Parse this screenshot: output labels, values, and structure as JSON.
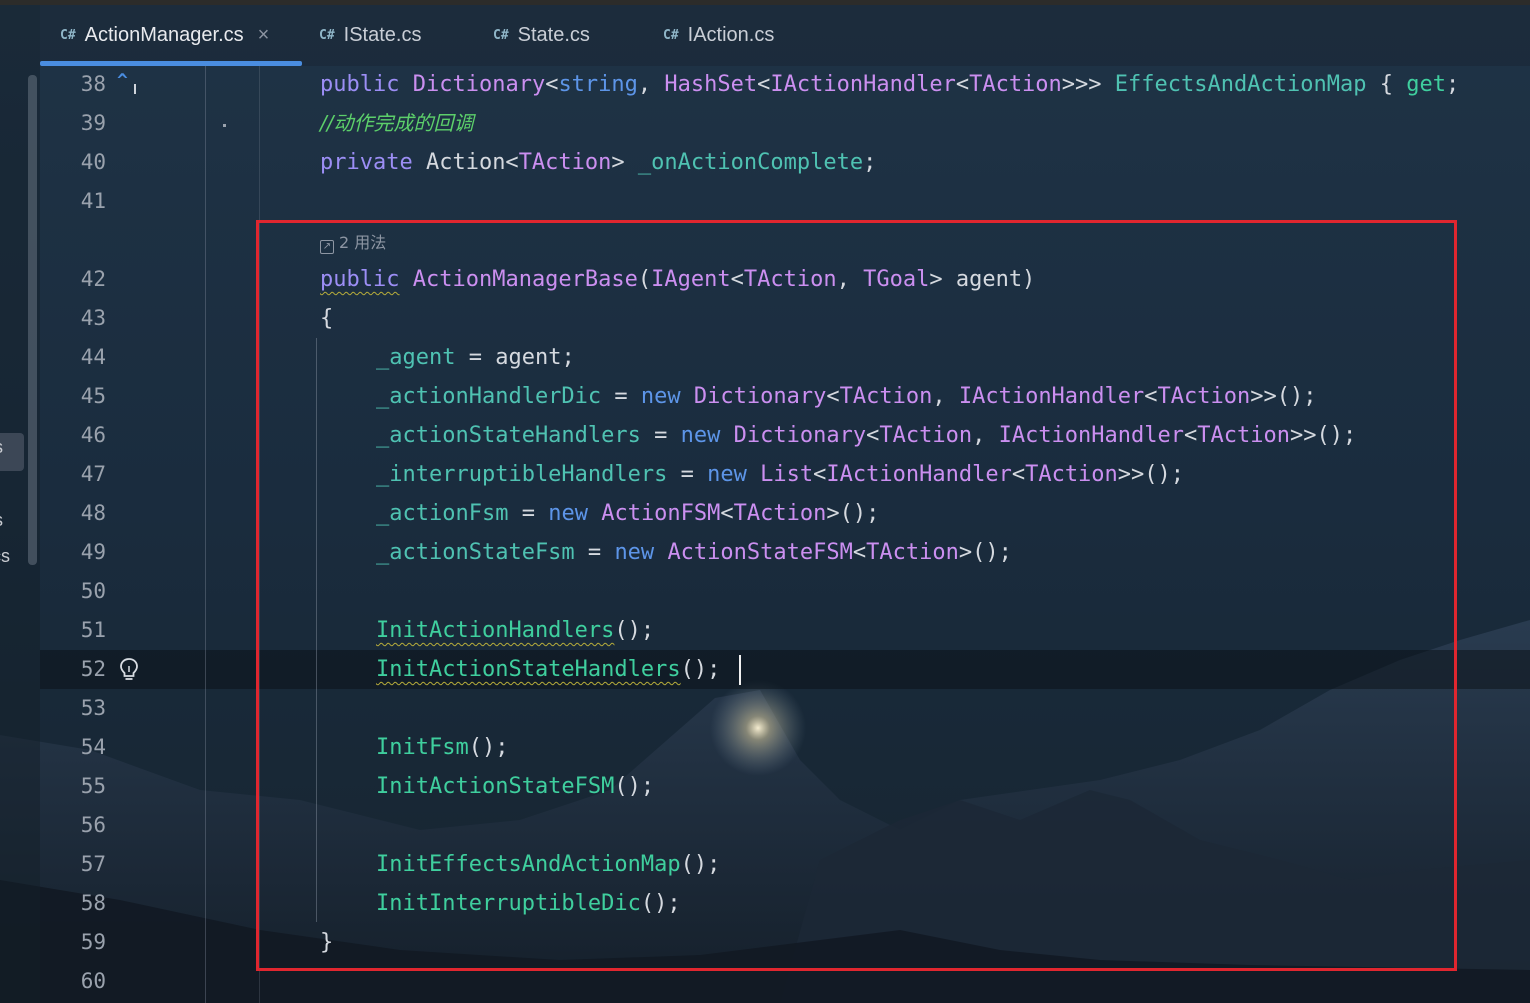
{
  "tabs": [
    {
      "icon": "C#",
      "label": "ActionManager.cs",
      "active": true,
      "close": "×"
    },
    {
      "icon": "C#",
      "label": "IState.cs",
      "active": false
    },
    {
      "icon": "C#",
      "label": "State.cs",
      "active": false
    },
    {
      "icon": "C#",
      "label": "IAction.cs",
      "active": false
    }
  ],
  "left_panel": {
    "clipped_items": [
      "s",
      "s",
      "cs"
    ]
  },
  "editor": {
    "line_numbers": [
      "38",
      "39",
      "40",
      "41",
      "42",
      "43",
      "44",
      "45",
      "46",
      "47",
      "48",
      "49",
      "50",
      "51",
      "52",
      "53",
      "54",
      "55",
      "56",
      "57",
      "58",
      "59",
      "60"
    ],
    "inlay_usages": "2 用法",
    "lines": {
      "l38": [
        {
          "c": "k",
          "t": "public"
        },
        {
          "c": "p",
          "t": " "
        },
        {
          "c": "t",
          "t": "Dictionary"
        },
        {
          "c": "p",
          "t": "<"
        },
        {
          "c": "kb",
          "t": "string"
        },
        {
          "c": "p",
          "t": ", "
        },
        {
          "c": "t",
          "t": "HashSet"
        },
        {
          "c": "p",
          "t": "<"
        },
        {
          "c": "t",
          "t": "IActionHandler"
        },
        {
          "c": "p",
          "t": "<"
        },
        {
          "c": "t",
          "t": "TAction"
        },
        {
          "c": "p",
          "t": ">>> "
        },
        {
          "c": "f",
          "t": "EffectsAndActionMap"
        },
        {
          "c": "p",
          "t": " { "
        },
        {
          "c": "m",
          "t": "get"
        },
        {
          "c": "p",
          "t": ";"
        }
      ],
      "l39": [
        {
          "c": "c",
          "t": "//动作完成的回调"
        }
      ],
      "l40": [
        {
          "c": "k",
          "t": "private"
        },
        {
          "c": "p",
          "t": " Action<"
        },
        {
          "c": "t",
          "t": "TAction"
        },
        {
          "c": "p",
          "t": "> "
        },
        {
          "c": "f",
          "t": "_onActionComplete"
        },
        {
          "c": "p",
          "t": ";"
        }
      ],
      "l42": [
        {
          "c": "k squig",
          "t": "public"
        },
        {
          "c": "p",
          "t": " "
        },
        {
          "c": "t",
          "t": "ActionManagerBase"
        },
        {
          "c": "p",
          "t": "("
        },
        {
          "c": "t",
          "t": "IAgent"
        },
        {
          "c": "p",
          "t": "<"
        },
        {
          "c": "t",
          "t": "TAction"
        },
        {
          "c": "p",
          "t": ", "
        },
        {
          "c": "t",
          "t": "TGoal"
        },
        {
          "c": "p",
          "t": "> agent)"
        }
      ],
      "l43": [
        {
          "c": "p",
          "t": "{"
        }
      ],
      "l44": [
        {
          "c": "f",
          "t": "_agent"
        },
        {
          "c": "p",
          "t": " = agent;"
        }
      ],
      "l45": [
        {
          "c": "f",
          "t": "_actionHandlerDic"
        },
        {
          "c": "p",
          "t": " = "
        },
        {
          "c": "kb",
          "t": "new"
        },
        {
          "c": "p",
          "t": " "
        },
        {
          "c": "t",
          "t": "Dictionary"
        },
        {
          "c": "p",
          "t": "<"
        },
        {
          "c": "t",
          "t": "TAction"
        },
        {
          "c": "p",
          "t": ", "
        },
        {
          "c": "t",
          "t": "IActionHandler"
        },
        {
          "c": "p",
          "t": "<"
        },
        {
          "c": "t",
          "t": "TAction"
        },
        {
          "c": "p",
          "t": ">>();"
        }
      ],
      "l46": [
        {
          "c": "f",
          "t": "_actionStateHandlers"
        },
        {
          "c": "p",
          "t": " = "
        },
        {
          "c": "kb",
          "t": "new"
        },
        {
          "c": "p",
          "t": " "
        },
        {
          "c": "t",
          "t": "Dictionary"
        },
        {
          "c": "p",
          "t": "<"
        },
        {
          "c": "t",
          "t": "TAction"
        },
        {
          "c": "p",
          "t": ", "
        },
        {
          "c": "t",
          "t": "IActionHandler"
        },
        {
          "c": "p",
          "t": "<"
        },
        {
          "c": "t",
          "t": "TAction"
        },
        {
          "c": "p",
          "t": ">>();"
        }
      ],
      "l47": [
        {
          "c": "f",
          "t": "_interruptibleHandlers"
        },
        {
          "c": "p",
          "t": " = "
        },
        {
          "c": "kb",
          "t": "new"
        },
        {
          "c": "p",
          "t": " "
        },
        {
          "c": "t",
          "t": "List"
        },
        {
          "c": "p",
          "t": "<"
        },
        {
          "c": "t",
          "t": "IActionHandler"
        },
        {
          "c": "p",
          "t": "<"
        },
        {
          "c": "t",
          "t": "TAction"
        },
        {
          "c": "p",
          "t": ">>();"
        }
      ],
      "l48": [
        {
          "c": "f",
          "t": "_actionFsm"
        },
        {
          "c": "p",
          "t": " = "
        },
        {
          "c": "kb",
          "t": "new"
        },
        {
          "c": "p",
          "t": " "
        },
        {
          "c": "t",
          "t": "ActionFSM"
        },
        {
          "c": "p",
          "t": "<"
        },
        {
          "c": "t",
          "t": "TAction"
        },
        {
          "c": "p",
          "t": ">();"
        }
      ],
      "l49": [
        {
          "c": "f",
          "t": "_actionStateFsm"
        },
        {
          "c": "p",
          "t": " = "
        },
        {
          "c": "kb",
          "t": "new"
        },
        {
          "c": "p",
          "t": " "
        },
        {
          "c": "t",
          "t": "ActionStateFSM"
        },
        {
          "c": "p",
          "t": "<"
        },
        {
          "c": "t",
          "t": "TAction"
        },
        {
          "c": "p",
          "t": ">();"
        }
      ],
      "l51": [
        {
          "c": "m squig",
          "t": "InitActionHandlers"
        },
        {
          "c": "p",
          "t": "();"
        }
      ],
      "l52": [
        {
          "c": "m squig",
          "t": "InitActionStateHandlers"
        },
        {
          "c": "p",
          "t": "();"
        }
      ],
      "l54": [
        {
          "c": "m",
          "t": "InitFsm"
        },
        {
          "c": "p",
          "t": "();"
        }
      ],
      "l55": [
        {
          "c": "m",
          "t": "InitActionStateFSM"
        },
        {
          "c": "p",
          "t": "();"
        }
      ],
      "l57": [
        {
          "c": "m",
          "t": "InitEffectsAndActionMap"
        },
        {
          "c": "p",
          "t": "();"
        }
      ],
      "l58": [
        {
          "c": "m",
          "t": "InitInterruptibleDic"
        },
        {
          "c": "p",
          "t": "();"
        }
      ],
      "l59": [
        {
          "c": "p",
          "t": "}"
        }
      ]
    }
  },
  "colors": {
    "keyword": "#9c8ef5",
    "type": "#cb8ff0",
    "method": "#3fcf9e",
    "field": "#4fc2b2",
    "comment": "#5ccf6a",
    "highlight_box": "#e0262f",
    "tab_accent": "#4a8de0"
  }
}
